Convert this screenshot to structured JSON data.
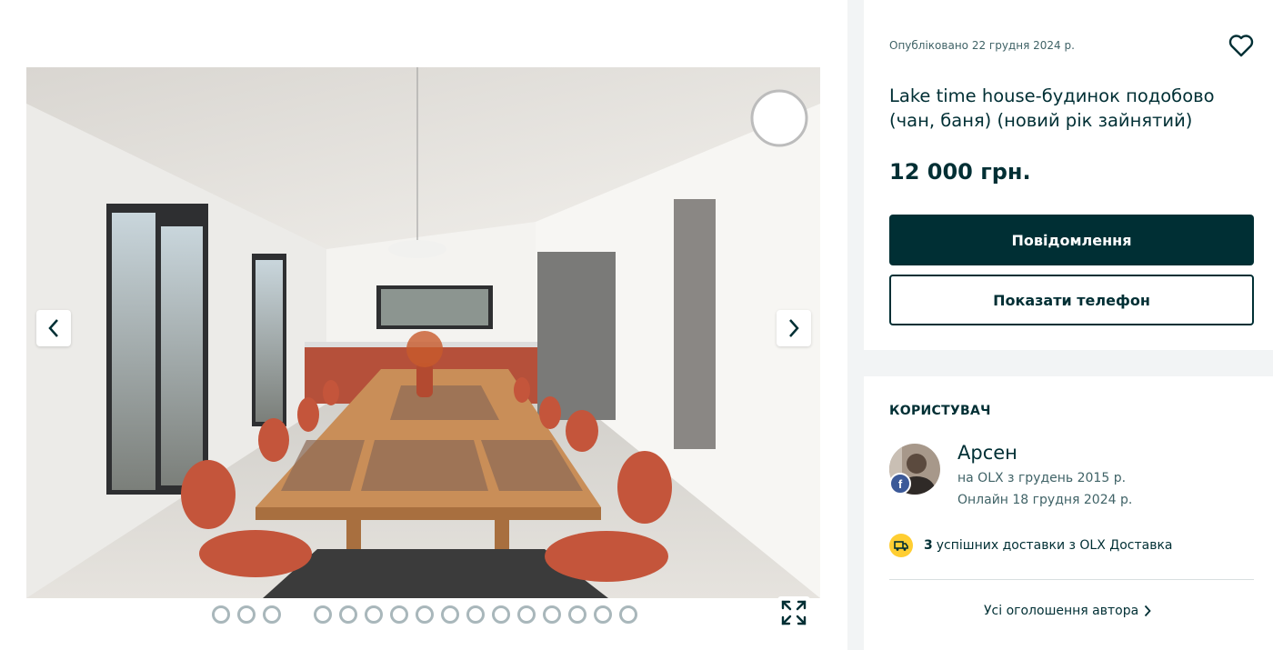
{
  "gallery": {
    "photo_alt": "Lake time house interior",
    "prev_icon": "chevron-left-icon",
    "next_icon": "chevron-right-icon",
    "dots_total": 16,
    "active_index": 0,
    "fullscreen_icon": "expand-icon"
  },
  "ad": {
    "posted": "Опубліковано 22 грудня 2024 р.",
    "title": "Lake time house-будинок подобово (чан, баня) (новий рік зайнятий)",
    "price": "12 000 грн.",
    "message_button": "Повідомлення",
    "phone_button": "Показати телефон",
    "favorite_icon": "heart-icon"
  },
  "user": {
    "heading": "КОРИСТУВАЧ",
    "name": "Арсен",
    "since": "на OLX з грудень 2015 р.",
    "online": "Онлайн 18 грудня 2024 р.",
    "social_badge": "f",
    "delivery_count": "3",
    "delivery_text": "успішних доставки з OLX Доставка",
    "all_ads_link": "Усі оголошення автора"
  },
  "colors": {
    "brand_dark": "#002f34",
    "muted_text": "#406367",
    "delivery_yellow": "#ffce32",
    "background": "#f2f4f5"
  }
}
